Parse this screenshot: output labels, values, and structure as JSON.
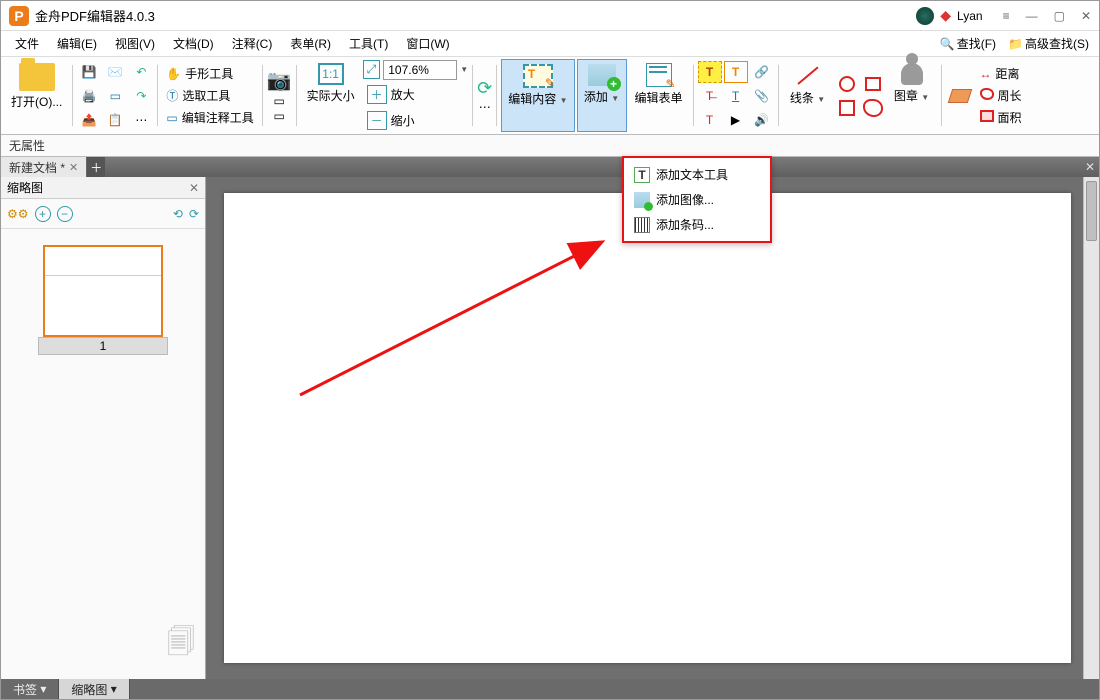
{
  "app": {
    "title": "金舟PDF编辑器4.0.3"
  },
  "user": {
    "name": "Lyan"
  },
  "menu": {
    "file": "文件",
    "edit": "编辑(E)",
    "view": "视图(V)",
    "doc": "文档(D)",
    "comment": "注释(C)",
    "table": "表单(R)",
    "tools": "工具(T)",
    "window": "窗口(W)",
    "find": "查找(F)",
    "adv_find": "高级查找(S)"
  },
  "toolbar": {
    "open": "打开(O)...",
    "hand_tool": "手形工具",
    "select_tool": "选取工具",
    "annot_tool": "编辑注释工具",
    "actual_size": "实际大小",
    "zoom_value": "107.6%",
    "zoom_in": "放大",
    "zoom_out": "缩小",
    "edit_content": "编辑内容",
    "add": "添加",
    "edit_form": "编辑表单",
    "lines": "线条",
    "stamp": "图章",
    "distance": "距离",
    "perimeter": "周长",
    "area": "面积"
  },
  "propbar": {
    "text": "无属性"
  },
  "tabs": {
    "doc1": "新建文档 *"
  },
  "sidebar": {
    "title": "缩略图",
    "page_num": "1",
    "bottom_bookmark": "书签",
    "bottom_thumbs": "缩略图"
  },
  "dropdown": {
    "add_text": "添加文本工具",
    "add_image": "添加图像...",
    "add_barcode": "添加条码..."
  }
}
